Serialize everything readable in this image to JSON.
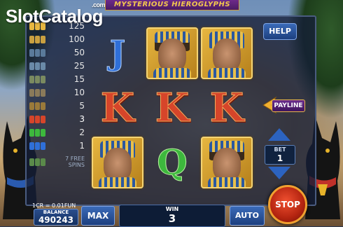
{
  "logo": {
    "part1": "Slot",
    "part2": "Catalog",
    "suffix": ".com"
  },
  "game_title": "MYSTERIOUS HIEROGLYPHS",
  "paytable": [
    {
      "icon": "pharaoh-woman-icon",
      "value": "125"
    },
    {
      "icon": "pharaoh-icon",
      "value": "100"
    },
    {
      "icon": "ankh-icon",
      "value": "50"
    },
    {
      "icon": "eye-icon",
      "value": "25"
    },
    {
      "icon": "scarab-icon",
      "value": "15"
    },
    {
      "icon": "bird-icon",
      "value": "10"
    },
    {
      "icon": "a-letter-icon",
      "value": "5"
    },
    {
      "icon": "k-letter-icon",
      "value": "3"
    },
    {
      "icon": "q-letter-icon",
      "value": "2"
    },
    {
      "icon": "j-letter-icon",
      "value": "1"
    },
    {
      "icon": "free-spins-icon",
      "value": "7 FREE SPINS"
    }
  ],
  "reels": {
    "row1": [
      "J",
      "pharaoh-woman",
      "pharaoh"
    ],
    "row2": [
      "K",
      "K",
      "K"
    ],
    "row3": [
      "pharaoh",
      "Q",
      "pharaoh-woman"
    ]
  },
  "buttons": {
    "help": "HELP",
    "payline": "PAYLINE",
    "max": "MAX",
    "auto": "AUTO",
    "stop": "STOP"
  },
  "bet": {
    "label": "BET",
    "value": "1"
  },
  "balance": {
    "label": "BALANCE",
    "value": "490243",
    "rate": "1CR = 0.01FUN"
  },
  "win": {
    "label": "WIN",
    "value": "3"
  },
  "colors": {
    "k_red": "#d6452a",
    "j_blue": "#2f6fd8",
    "q_green": "#3db83d",
    "gold": "#e6b640",
    "button_blue": "#2c63c0"
  }
}
